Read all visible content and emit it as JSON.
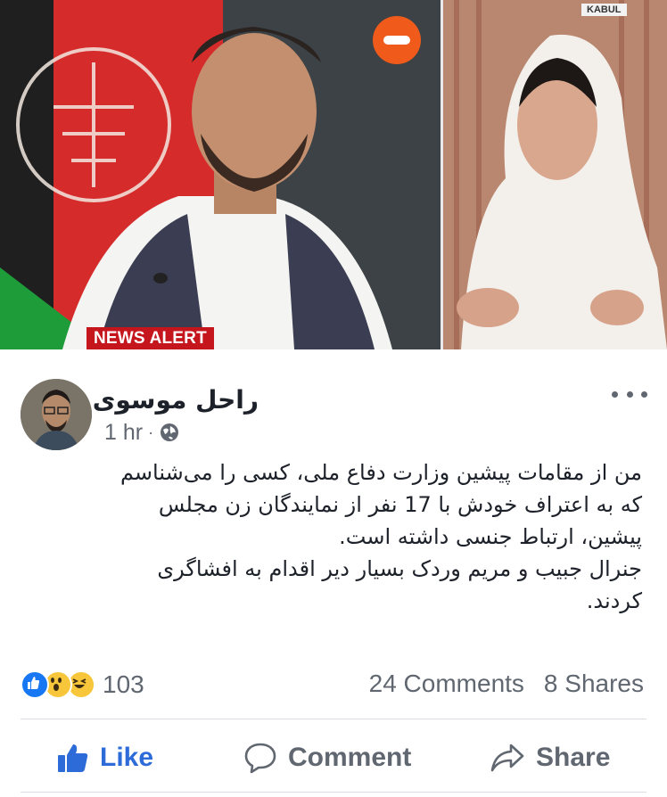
{
  "media": {
    "news_alert": "NEWS ALERT",
    "kabul": "KABUL"
  },
  "post": {
    "author_name": "راحل موسوی",
    "time": "1 hr",
    "separator": "·",
    "text_lines": [
      "من از مقامات پیشین وزارت دفاع ملی، کسی را می‌شناسم",
      "که به اعتراف خودش با 17 نفر از نمایندگان زن مجلس",
      "پیشین، ارتباط جنسی داشته است.",
      "جنرال جبیب و مریم وردک بسیار دیر اقدام به افشاگری",
      "کردند."
    ]
  },
  "stats": {
    "reaction_count": "103",
    "comments": "24 Comments",
    "shares": "8 Shares",
    "reaction_icons": [
      "like-icon",
      "wow-icon",
      "haha-icon"
    ]
  },
  "actions": {
    "like": "Like",
    "comment": "Comment",
    "share": "Share"
  },
  "colors": {
    "like_blue": "#2d6bd8",
    "meta_gray": "#606770",
    "news_alert_red": "#c4161c",
    "channel_orange": "#f05a1a"
  }
}
